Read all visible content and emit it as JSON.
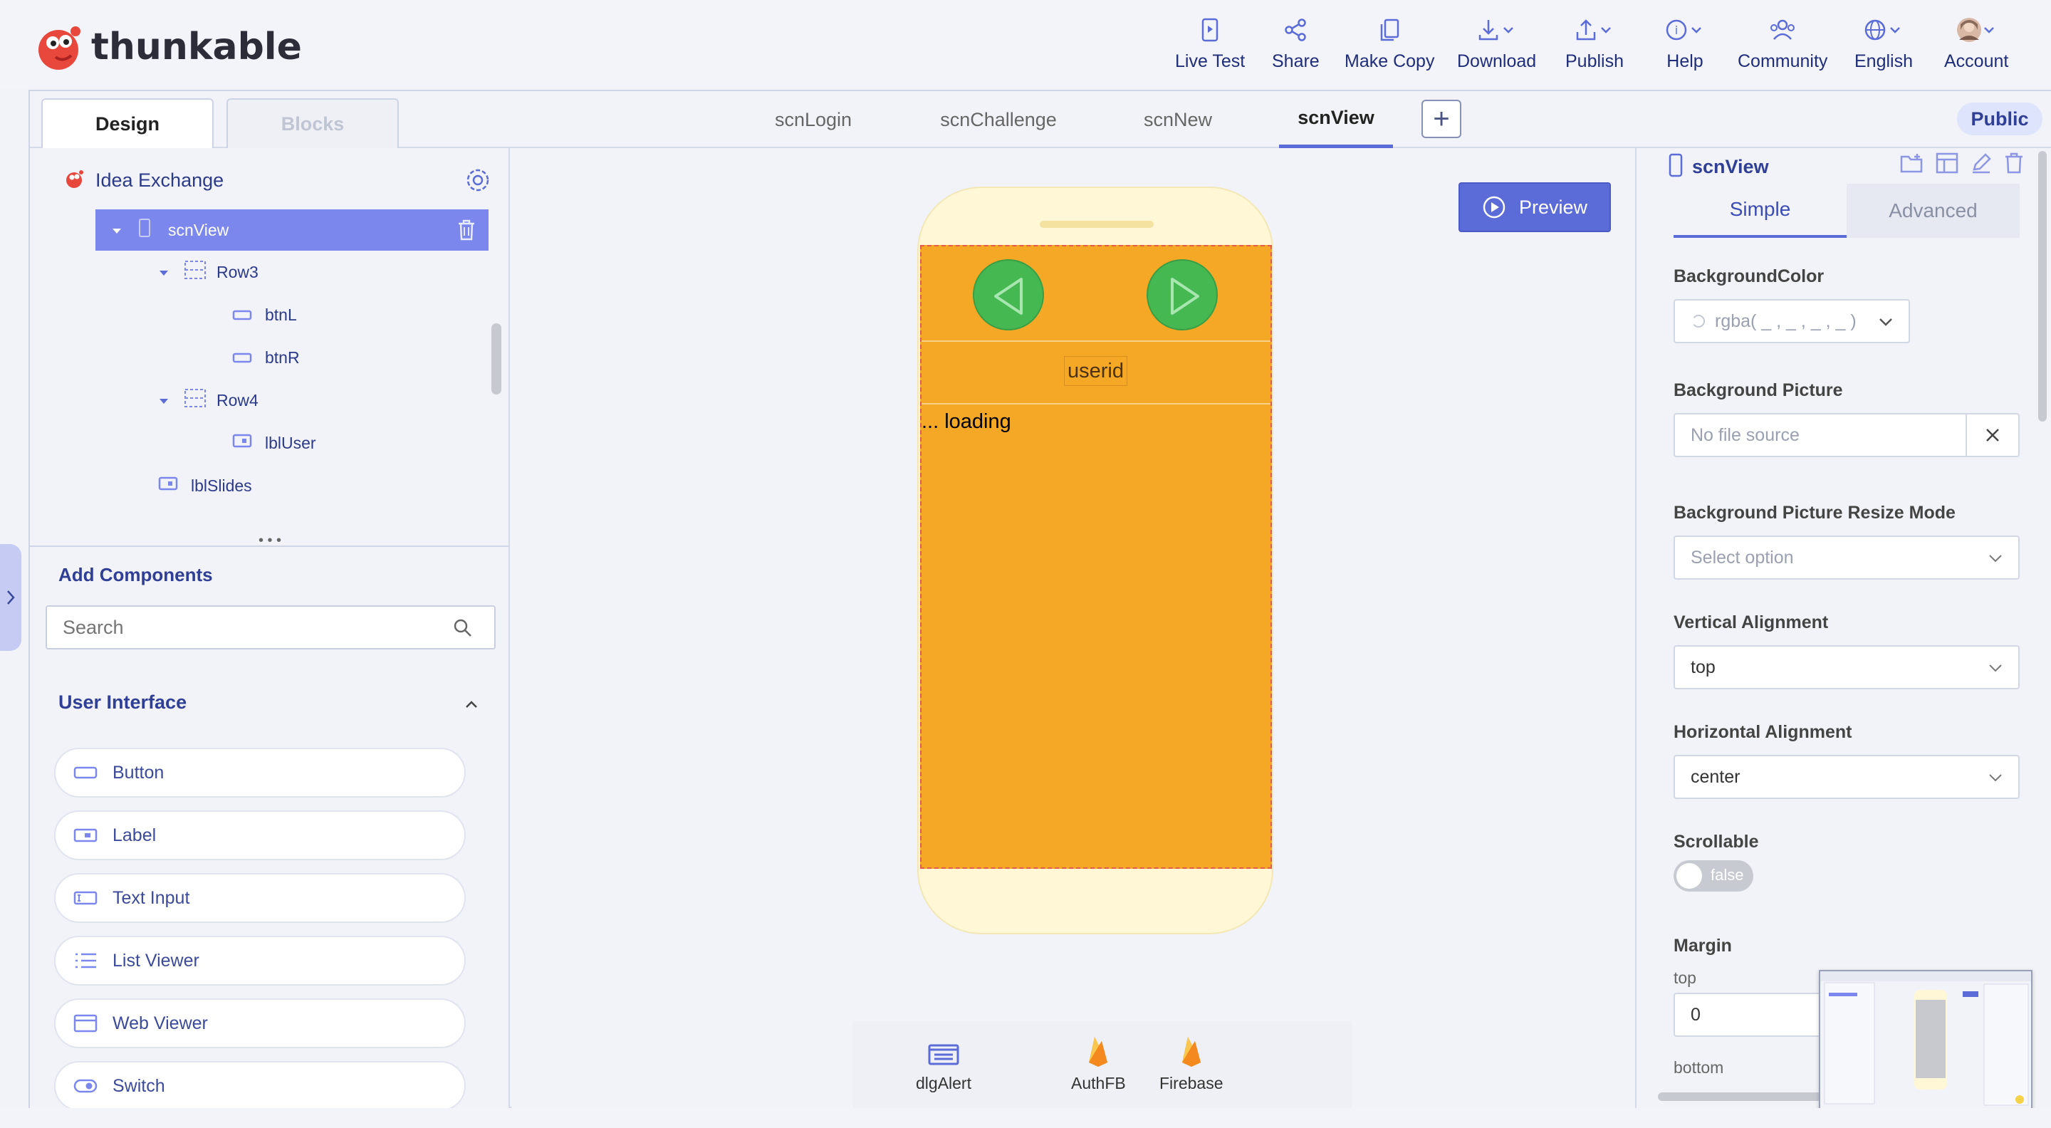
{
  "app": {
    "brand": "thunkable"
  },
  "topnav": [
    {
      "label": "Live Test",
      "icon": "live-test-icon"
    },
    {
      "label": "Share",
      "icon": "share-icon"
    },
    {
      "label": "Make Copy",
      "icon": "copy-icon"
    },
    {
      "label": "Download",
      "icon": "download-icon"
    },
    {
      "label": "Publish",
      "icon": "publish-icon"
    },
    {
      "label": "Help",
      "icon": "help-icon"
    },
    {
      "label": "Community",
      "icon": "community-icon"
    },
    {
      "label": "English",
      "icon": "globe-icon"
    },
    {
      "label": "Account",
      "icon": "avatar"
    }
  ],
  "mode_tabs": {
    "design": "Design",
    "blocks": "Blocks"
  },
  "screen_tabs": [
    "scnLogin",
    "scnChallenge",
    "scnNew",
    "scnView"
  ],
  "active_screen": "scnView",
  "add_screen": "+",
  "visibility": "Public",
  "project": {
    "name": "Idea Exchange"
  },
  "tree": {
    "selected": "scnView",
    "items": [
      {
        "label": "Row3"
      },
      {
        "label": "btnL"
      },
      {
        "label": "btnR"
      },
      {
        "label": "Row4"
      },
      {
        "label": "lblUser"
      },
      {
        "label": "lblSlides"
      }
    ]
  },
  "divider_dots": "• • •",
  "components": {
    "title": "Add Components",
    "search_placeholder": "Search",
    "section": "User Interface",
    "items": [
      {
        "label": "Button",
        "icon": "button-icon"
      },
      {
        "label": "Label",
        "icon": "label-icon"
      },
      {
        "label": "Text Input",
        "icon": "text-input-icon"
      },
      {
        "label": "List Viewer",
        "icon": "list-icon"
      },
      {
        "label": "Web Viewer",
        "icon": "web-viewer-icon"
      },
      {
        "label": "Switch",
        "icon": "switch-icon"
      }
    ]
  },
  "canvas": {
    "preview_label": "Preview",
    "userid": "userid",
    "loading": "... loading",
    "screen_bg": "#f4a825",
    "button_color": "#46b852"
  },
  "nonvisual": [
    {
      "label": "dlgAlert",
      "icon": "dialog-icon"
    },
    {
      "label": "AuthFB",
      "icon": "firebase-icon"
    },
    {
      "label": "Firebase",
      "icon": "firebase-icon"
    }
  ],
  "properties": {
    "screen_name": "scnView",
    "tabs": {
      "simple": "Simple",
      "advanced": "Advanced"
    },
    "bg_color_label": "BackgroundColor",
    "bg_color_value": "rgba( _ , _ , _ , _ )",
    "bg_picture_label": "Background Picture",
    "bg_picture_value": "No file source",
    "resize_label": "Background Picture Resize Mode",
    "resize_value": "Select option",
    "valign_label": "Vertical Alignment",
    "valign_value": "top",
    "halign_label": "Horizontal Alignment",
    "halign_value": "center",
    "scrollable_label": "Scrollable",
    "scrollable_value": "false",
    "margin_label": "Margin",
    "margin_top_label": "top",
    "margin_top_value": "0",
    "margin_bottom_label": "bottom"
  }
}
